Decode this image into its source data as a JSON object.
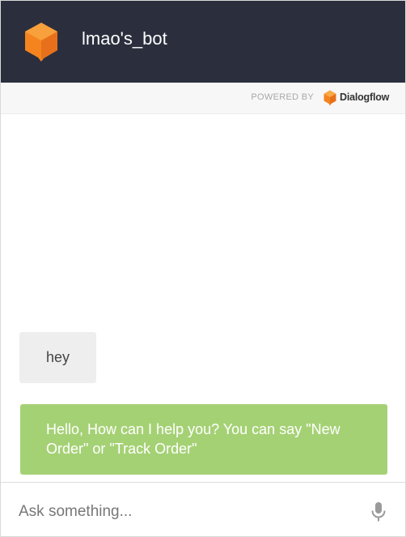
{
  "header": {
    "bot_name": "lmao's_bot",
    "logo_icon": "dialogflow-cube-icon"
  },
  "powered_by": {
    "label": "POWERED BY",
    "brand": "Dialogflow",
    "brand_icon": "dialogflow-icon"
  },
  "messages": [
    {
      "from": "user",
      "text": "hey"
    },
    {
      "from": "bot",
      "text": "Hello, How can I help you? You can say \"New Order\" or \"Track Order\""
    }
  ],
  "input": {
    "placeholder": "Ask something...",
    "value": "",
    "mic_icon": "microphone-icon"
  },
  "colors": {
    "header_bg": "#2b2f3d",
    "bot_bubble": "#a5d175",
    "user_bubble": "#eeeeee",
    "accent_orange": "#f5841f"
  }
}
